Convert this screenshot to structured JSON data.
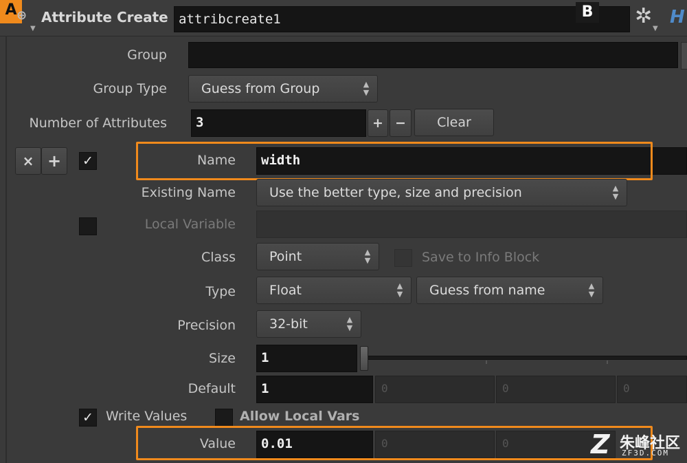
{
  "header": {
    "badge_a": "A",
    "badge_b": "B",
    "node_type": "Attribute Create",
    "node_name": "attribcreate1",
    "node_icon": "node-type-icon",
    "gear_icon": "gear-icon",
    "help_letter": "H"
  },
  "params": {
    "group_label": "Group",
    "group_value": "",
    "group_type_label": "Group Type",
    "group_type_value": "Guess from Group",
    "num_attribs_label": "Number of Attributes",
    "num_attribs_value": "3",
    "plus": "+",
    "minus": "−",
    "clear": "Clear",
    "remove_x": "×",
    "insert_plus": "+",
    "name_label": "Name",
    "name_value": "width",
    "existing_label": "Existing Name",
    "existing_value": "Use the better type, size and precision",
    "localvar_label": "Local Variable",
    "class_label": "Class",
    "class_value": "Point",
    "save_info_label": "Save to Info Block",
    "type_label": "Type",
    "type_value": "Float",
    "typeinfo_value": "Guess from name",
    "precision_label": "Precision",
    "precision_value": "32-bit",
    "size_label": "Size",
    "size_value": "1",
    "size_slider_level": 0,
    "default_label": "Default",
    "default_values": [
      "1",
      "0",
      "0",
      "0"
    ],
    "write_values_label": "Write Values",
    "allow_local_label": "Allow Local Vars",
    "value_label": "Value",
    "value_values": [
      "0.01",
      "0",
      "0"
    ]
  },
  "watermark": {
    "logo": "朱峰社区",
    "site": "ZF3D.COM"
  },
  "colors": {
    "highlight": "#f08a1c",
    "panel": "#3a3a3a",
    "field": "#151515"
  }
}
